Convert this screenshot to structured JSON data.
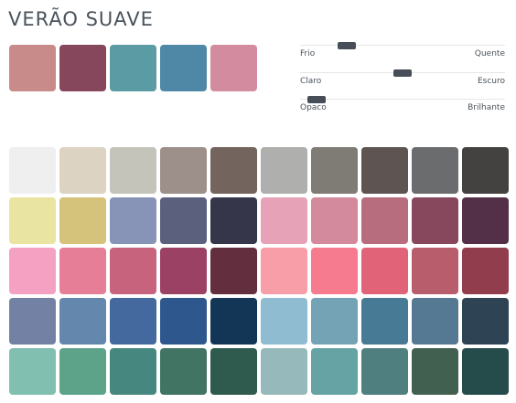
{
  "title": "VERÃO SUAVE",
  "featured": [
    "#c98a8a",
    "#86475c",
    "#5b9ba3",
    "#4f88a6",
    "#d38ba0"
  ],
  "sliders": [
    {
      "left": "Frio",
      "right": "Quente",
      "value": 0.2
    },
    {
      "left": "Claro",
      "right": "Escuro",
      "value": 0.5
    },
    {
      "left": "Opaco",
      "right": "Brilhante",
      "value": 0.04
    }
  ],
  "palette": [
    [
      "#efefef",
      "#ddd3c3",
      "#c5c4ba",
      "#9d908b",
      "#74645e",
      "#afafad",
      "#7e7c74",
      "#5e5552",
      "#6b6c6e",
      "#434240"
    ],
    [
      "#e9e4a2",
      "#d5c27b",
      "#8894b7",
      "#5b607d",
      "#36364b",
      "#e6a3b8",
      "#d38a9d",
      "#b76d7e",
      "#87475d",
      "#542f48"
    ],
    [
      "#f5a2c2",
      "#e77e98",
      "#c7637d",
      "#9b4163",
      "#632f3e",
      "#f79ea8",
      "#f67b8e",
      "#e06377",
      "#b85d6c",
      "#923d4e"
    ],
    [
      "#7382a4",
      "#6488ad",
      "#44699e",
      "#2e588d",
      "#143656",
      "#8fbcd0",
      "#73a3b5",
      "#477a95",
      "#557893",
      "#2e4354"
    ],
    [
      "#81c0b0",
      "#5ca38a",
      "#468880",
      "#417462",
      "#2f5b4e",
      "#96babb",
      "#66a3a4",
      "#4f7f7e",
      "#41604f",
      "#254b4b"
    ]
  ]
}
